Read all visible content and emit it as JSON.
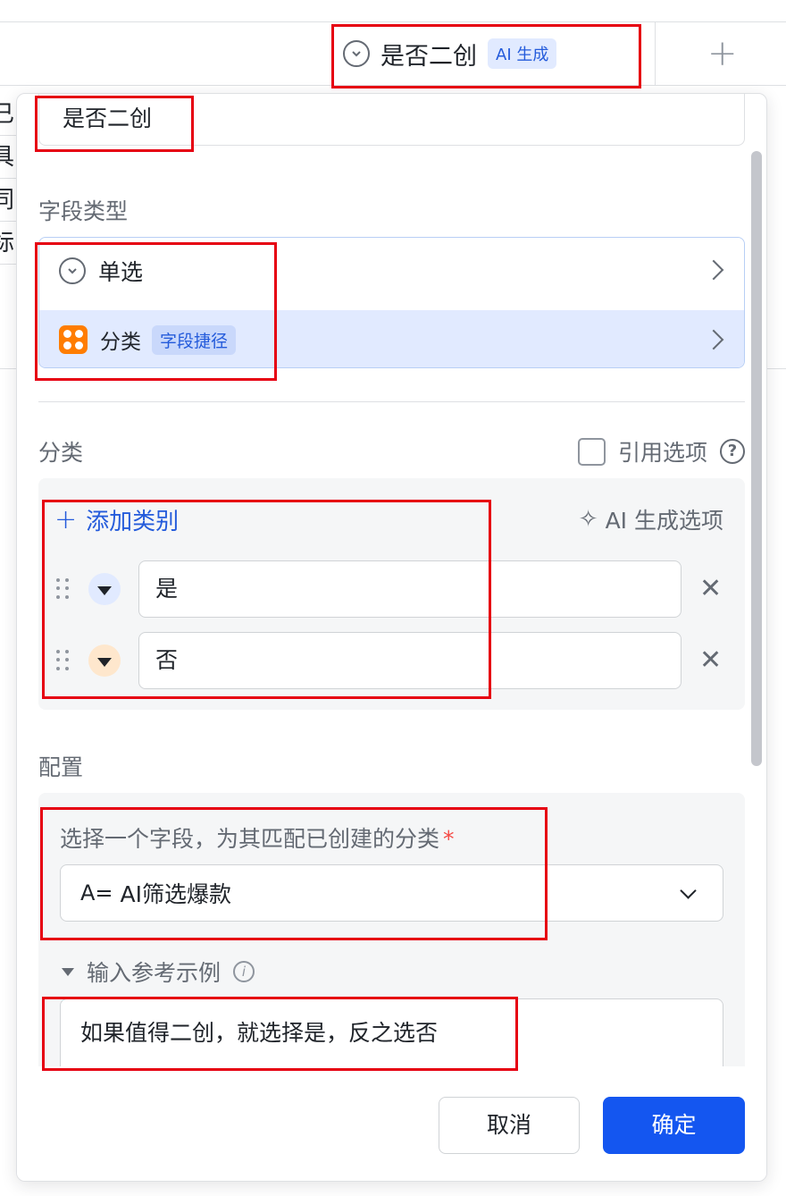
{
  "table": {
    "column_title": "是否二创",
    "column_badge": "AI 生成",
    "add_column_icon": "plus-icon",
    "row_fragments": [
      "已",
      "具",
      "同",
      "标"
    ]
  },
  "panel": {
    "field_name": "是否二创",
    "field_type_label": "字段类型",
    "field_type_options": [
      {
        "label": "单选",
        "icon": "circle-chevron-down-icon"
      },
      {
        "label": "分类",
        "tag": "字段捷径",
        "icon": "category-icon"
      }
    ],
    "category_section": {
      "title": "分类",
      "reference_option_label": "引用选项",
      "add_label": "添加类别",
      "ai_generate_label": "AI 生成选项",
      "options": [
        {
          "value": "是",
          "color": "#e1eaff"
        },
        {
          "value": "否",
          "color": "#fee7cd"
        }
      ]
    },
    "config_section": {
      "title": "配置",
      "question": "选择一个字段，为其匹配已创建的分类",
      "required_mark": "*",
      "selected_field": "AI筛选爆款",
      "example_toggle_label": "输入参考示例",
      "example_text": "如果值得二创，就选择是，反之选否"
    },
    "buttons": {
      "cancel": "取消",
      "ok": "确定"
    }
  },
  "colors": {
    "accent": "#1456f0",
    "annotation": "#e60012",
    "category_icon": "#ff7d00"
  }
}
